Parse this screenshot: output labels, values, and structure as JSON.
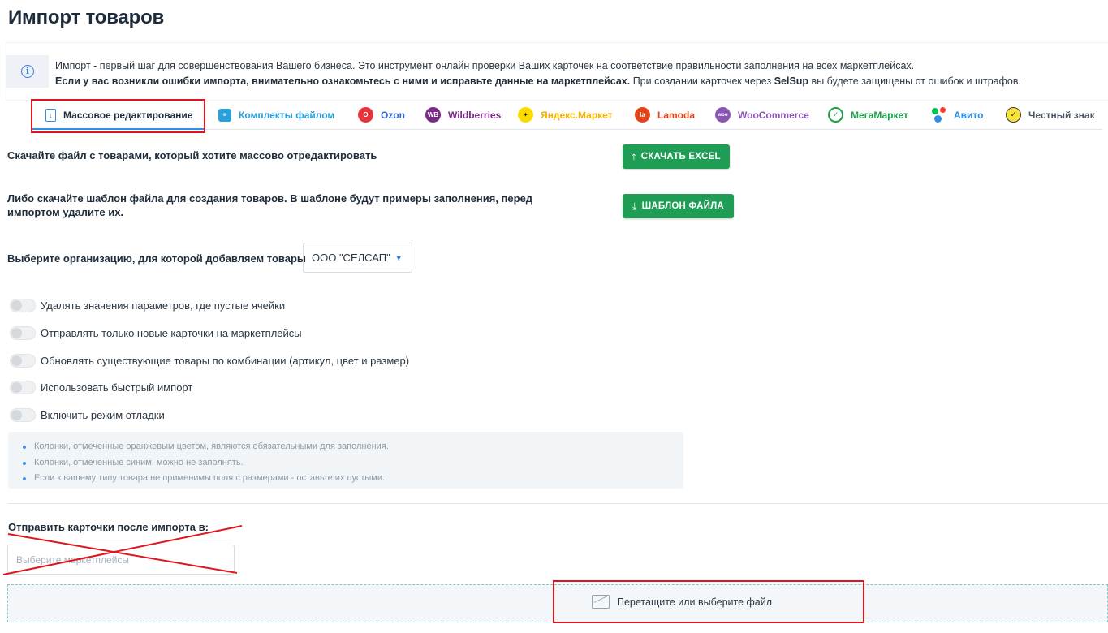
{
  "page": {
    "title": "Импорт товаров"
  },
  "info": {
    "line1": "Импорт - первый шаг для совершенствования Вашего бизнеса. Это инструмент онлайн проверки Ваших карточек на соответствие правильности заполнения на всех маркетплейсах.",
    "line2_bold": "Если у вас возникли ошибки импорта, внимательно ознакомьтесь с ними и исправьте данные на маркетплейсах.",
    "line2_pre": "При создании карточек через",
    "line2_brand": "SelSup",
    "line2_post": "вы будете защищены от ошибок и штрафов."
  },
  "tabs": [
    {
      "label": "Массовое редактирование",
      "color": "#1f2d3a",
      "icon": "file-edit-icon",
      "active": true
    },
    {
      "label": "Комплекты файлом",
      "color": "#2a9fd8",
      "icon": "stack-icon"
    },
    {
      "label": "Ozon",
      "color": "#3466d6",
      "icon": "ozon-icon"
    },
    {
      "label": "Wildberries",
      "color": "#7a2b86",
      "icon": "wildberries-icon"
    },
    {
      "label": "Яндекс.Маркет",
      "color": "#f5b300",
      "icon": "yandex-market-icon"
    },
    {
      "label": "Lamoda",
      "color": "#e2451a",
      "icon": "lamoda-icon"
    },
    {
      "label": "WooCommerce",
      "color": "#8a55b3",
      "icon": "woocommerce-icon"
    },
    {
      "label": "МегаМаркет",
      "color": "#1fa14a",
      "icon": "megamarket-icon"
    },
    {
      "label": "Авито",
      "color": "#2f8fe6",
      "icon": "avito-icon"
    },
    {
      "label": "Честный знак",
      "color": "#4d5864",
      "icon": "chestny-znak-icon"
    }
  ],
  "download": {
    "label": "Скачайте файл с товарами, который хотите массово отредактировать",
    "button": "СКАЧАТЬ EXCEL"
  },
  "template": {
    "label_line1": "Либо скачайте шаблон файла для создания товаров. В шаблоне будут примеры заполнения, перед",
    "label_line2": "импортом удалите их.",
    "button": "ШАБЛОН ФАЙЛА"
  },
  "organization": {
    "label": "Выберите организацию, для которой добавляем товары",
    "value": "ООО \"СЕЛСАП\""
  },
  "toggles": [
    {
      "label": "Удалять значения параметров, где пустые ячейки",
      "on": false
    },
    {
      "label": "Отправлять только новые карточки на маркетплейсы",
      "on": false
    },
    {
      "label": "Обновлять существующие товары по комбинации (артикул, цвет и размер)",
      "on": false
    },
    {
      "label": "Использовать быстрый импорт",
      "on": false
    },
    {
      "label": "Включить режим отладки",
      "on": false
    }
  ],
  "notes": [
    "Колонки, отмеченные оранжевым цветом, являются обязательными для заполнения.",
    "Колонки, отмеченные синим, можно не заполнять.",
    "Если к вашему типу товара не применимы поля с размерами - оставьте их пустыми."
  ],
  "send": {
    "label": "Отправить карточки после импорта в:",
    "placeholder": "Выберите маркетплейсы"
  },
  "dropzone": {
    "label": "Перетащите или выберите файл"
  },
  "colors": {
    "accent_green": "#1f9d55",
    "highlight_red": "#e0141d",
    "accent_blue": "#2f8fe6"
  }
}
